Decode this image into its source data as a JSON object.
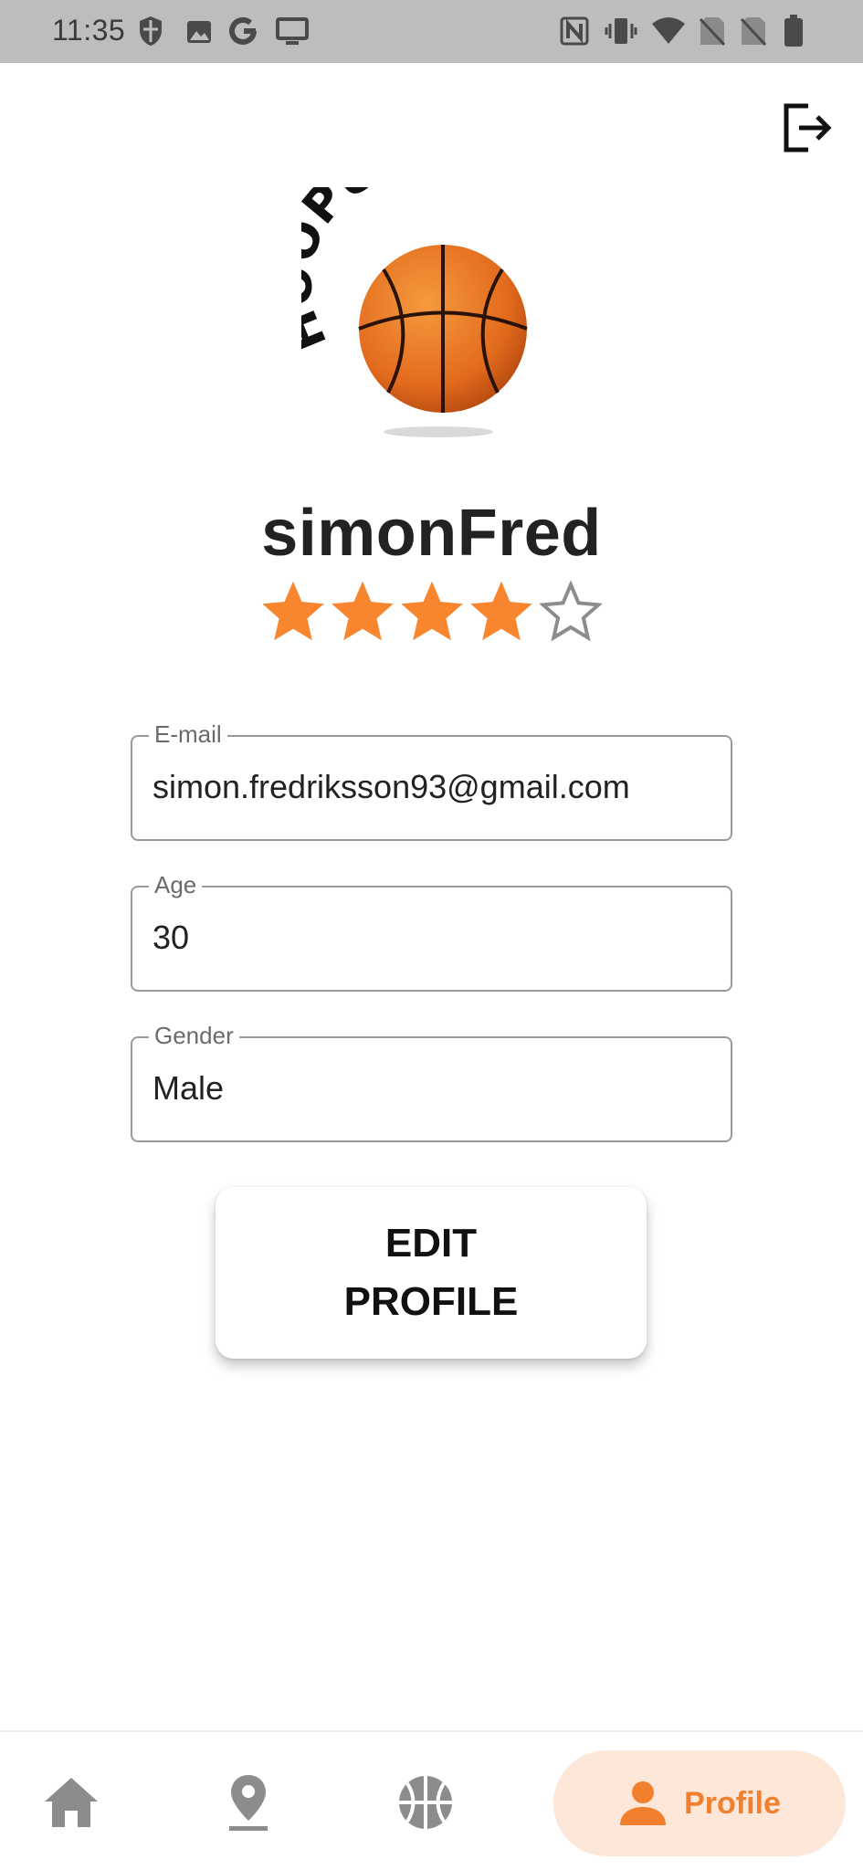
{
  "status_bar": {
    "time": "11:35",
    "left_icons": [
      "shield-icon",
      "image-icon",
      "google-icon",
      "monitor-icon"
    ],
    "right_icons": [
      "nfc-icon",
      "vibrate-icon",
      "wifi-icon",
      "no-sim-icon",
      "no-sim-icon",
      "battery-icon"
    ]
  },
  "header": {
    "logout_icon": "logout-icon"
  },
  "logo": {
    "text": "HOOPUP",
    "ball_color": "#e26b1d"
  },
  "profile": {
    "username": "simonFred",
    "rating": 4,
    "rating_max": 5,
    "star_color": "#f7862e"
  },
  "fields": {
    "email": {
      "label": "E-mail",
      "value": "simon.fredriksson93@gmail.com"
    },
    "age": {
      "label": "Age",
      "value": "30"
    },
    "gender": {
      "label": "Gender",
      "value": "Male"
    }
  },
  "edit_button": {
    "label": "EDIT PROFILE"
  },
  "bottom_nav": {
    "items": [
      {
        "icon": "home-icon"
      },
      {
        "icon": "map-pin-icon"
      },
      {
        "icon": "basketball-icon"
      },
      {
        "icon": "person-icon",
        "label": "Profile",
        "active": true
      }
    ],
    "accent": "#f07f2e",
    "active_bg": "#fde7d8"
  }
}
